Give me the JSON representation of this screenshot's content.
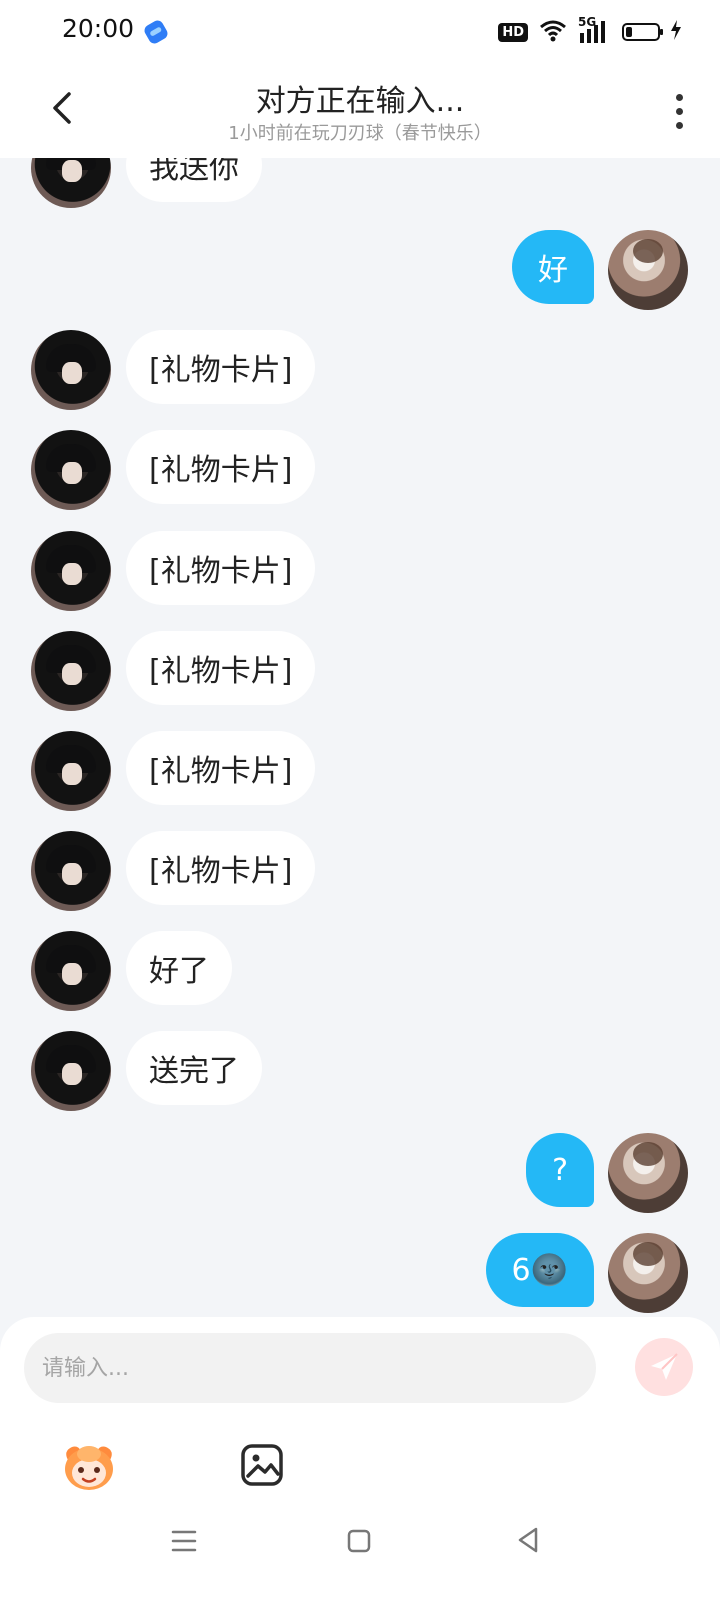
{
  "status_bar": {
    "time": "20:00",
    "hd_label": "HD",
    "network_label": "5G"
  },
  "header": {
    "title": "对方正在输入...",
    "subtitle": "1小时前在玩刀刃球（春节快乐）"
  },
  "messages": [
    {
      "side": "left",
      "text": "我送你"
    },
    {
      "side": "right",
      "text": "好"
    },
    {
      "side": "left",
      "text": "[礼物卡片]"
    },
    {
      "side": "left",
      "text": "[礼物卡片]"
    },
    {
      "side": "left",
      "text": "[礼物卡片]"
    },
    {
      "side": "left",
      "text": "[礼物卡片]"
    },
    {
      "side": "left",
      "text": "[礼物卡片]"
    },
    {
      "side": "left",
      "text": "[礼物卡片]"
    },
    {
      "side": "left",
      "text": "好了"
    },
    {
      "side": "left",
      "text": "送完了"
    },
    {
      "side": "right",
      "text": "?"
    },
    {
      "side": "right",
      "text": "6🌚"
    }
  ],
  "composer": {
    "placeholder": "请输入...",
    "emoji_icon": "monkey-emoji-icon",
    "gallery_icon": "image-icon",
    "send_icon": "send-icon"
  },
  "navbar": {
    "menu_icon": "menu-icon",
    "home_icon": "home-icon",
    "back_icon": "back-triangle-icon"
  },
  "colors": {
    "accent": "#24b8f6",
    "background": "#f3f5f8",
    "bubble_left": "#ffffff",
    "send_button": "#ffe0e0"
  }
}
